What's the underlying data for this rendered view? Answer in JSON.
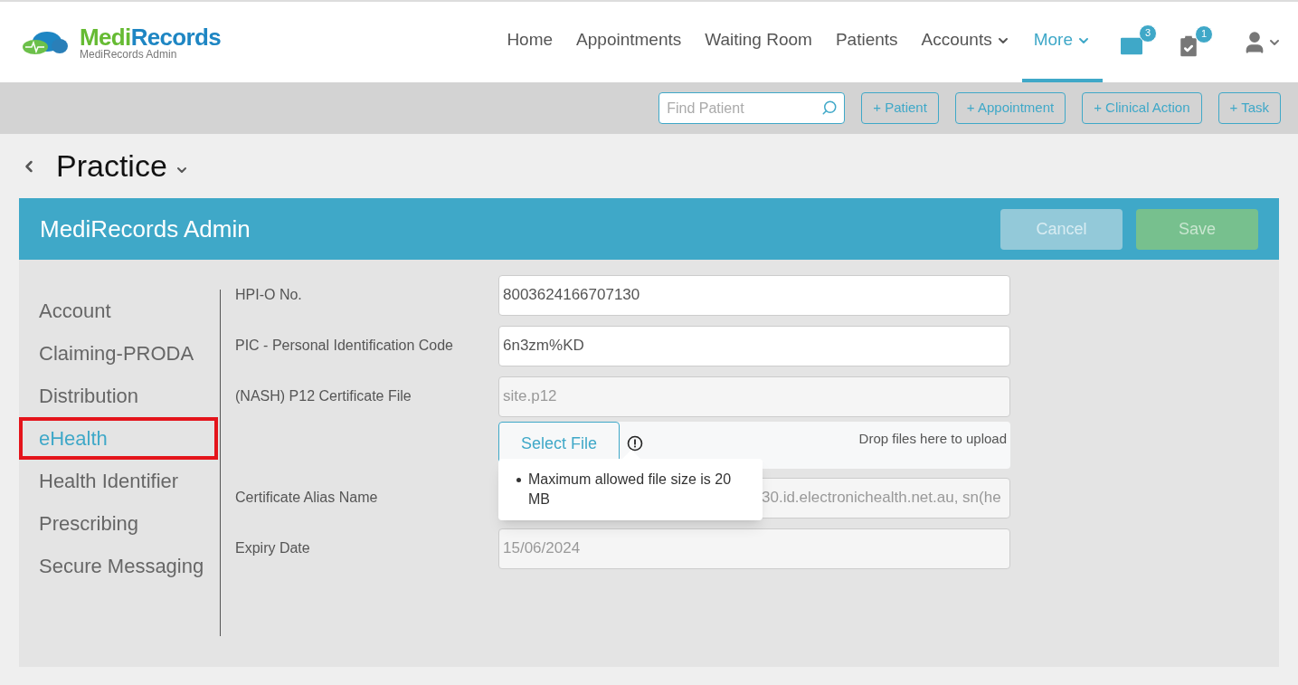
{
  "logo": {
    "brand_left": "Medi",
    "brand_right": "Records",
    "subtitle": "MediRecords Admin"
  },
  "nav": [
    {
      "label": "Home",
      "selected": false,
      "dropdown": false
    },
    {
      "label": "Appointments",
      "selected": false,
      "dropdown": false
    },
    {
      "label": "Waiting Room",
      "selected": false,
      "dropdown": false
    },
    {
      "label": "Patients",
      "selected": false,
      "dropdown": false
    },
    {
      "label": "Accounts",
      "selected": false,
      "dropdown": true
    },
    {
      "label": "More",
      "selected": true,
      "dropdown": true
    }
  ],
  "notifications": {
    "messages": "3",
    "tasks": "1"
  },
  "toolbar": {
    "search": {
      "placeholder": "Find Patient"
    },
    "buttons": [
      "+ Patient",
      "+ Appointment",
      "+ Clinical Action",
      "+ Task"
    ]
  },
  "page_title": "Practice",
  "panel": {
    "title": "MediRecords Admin",
    "cancel": "Cancel",
    "save": "Save"
  },
  "sidebar": [
    {
      "label": "Account",
      "selected": false,
      "highlighted": false
    },
    {
      "label": "Claiming-PRODA",
      "selected": false,
      "highlighted": false
    },
    {
      "label": "Distribution",
      "selected": false,
      "highlighted": false
    },
    {
      "label": "eHealth",
      "selected": true,
      "highlighted": true
    },
    {
      "label": "Health Identifier",
      "selected": false,
      "highlighted": false
    },
    {
      "label": "Prescribing",
      "selected": false,
      "highlighted": false
    },
    {
      "label": "Secure Messaging",
      "selected": false,
      "highlighted": false
    }
  ],
  "fields": [
    {
      "kind": "text",
      "label": "HPI-O No.",
      "value": "8003624166707130"
    },
    {
      "kind": "text",
      "label": "PIC - Personal Identification Code",
      "value": "6n3zm%KD"
    },
    {
      "kind": "readonly",
      "label": "(NASH) P12 Certificate File",
      "value": "site.p12"
    },
    {
      "kind": "upload",
      "button": "Select File",
      "drop_hint": "Drop files here to upload",
      "tooltip": "Maximum allowed file size is 20 MB"
    },
    {
      "kind": "readonly",
      "label": "Certificate Alias Name",
      "value": "30.id.electronichealth.net.au, sn(he",
      "covered": true
    },
    {
      "kind": "readonly",
      "label": "Expiry Date",
      "value": "15/06/2024"
    }
  ]
}
